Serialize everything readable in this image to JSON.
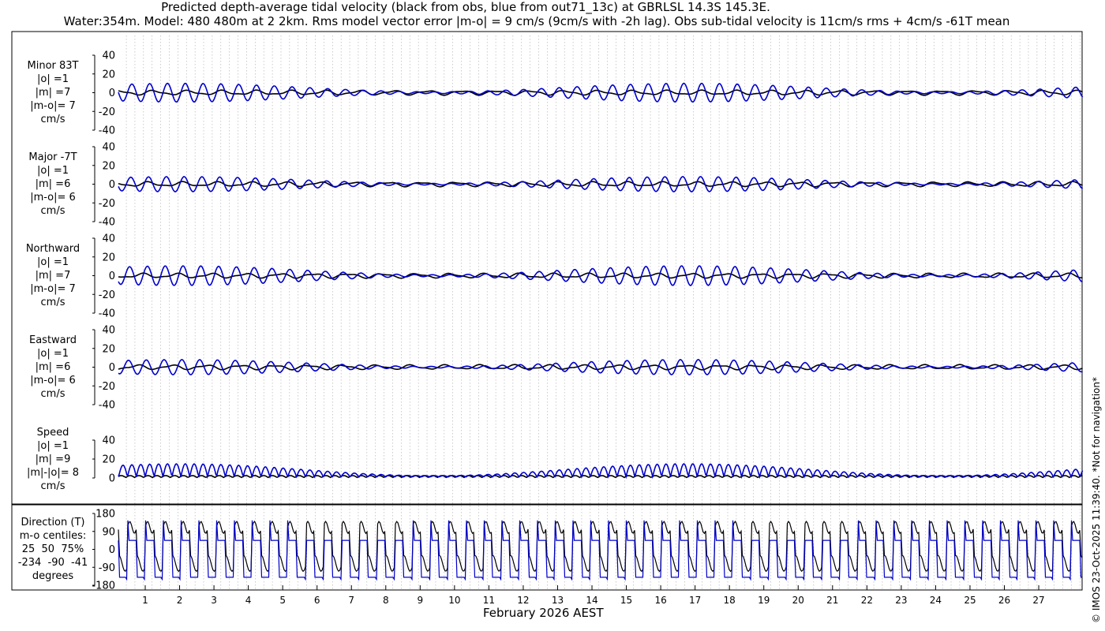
{
  "title": {
    "line1": "Predicted depth-average tidal velocity (black from obs, blue from out71_13c) at GBRLSL 14.3S 145.3E.",
    "line2": "Water:354m. Model: 480 480m at 2 2km. Rms model vector error |m-o| = 9 cm/s (9cm/s with -2h lag). Obs sub-tidal velocity is 11cm/s rms + 4cm/s -61T mean"
  },
  "xlabel": "February 2026 AEST",
  "copyright": "© IMOS 23-Oct-2025 11:39:40. *Not for navigation*",
  "colors": {
    "obs": "#000000",
    "model": "#0000cc",
    "grid": "#aaaaaa"
  },
  "chart_data": [
    {
      "type": "line",
      "panel": "minor",
      "label": [
        "Minor 83T",
        "|o| =1",
        "|m| =7",
        "|m-o|= 7",
        "cm/s"
      ],
      "yticks": [
        40,
        20,
        0,
        -20,
        -40
      ],
      "ylim": [
        -40,
        40
      ],
      "x_days": [
        1,
        27
      ],
      "series": [
        {
          "name": "obs",
          "amplitude": 2
        },
        {
          "name": "model",
          "amplitude": 10
        }
      ]
    },
    {
      "type": "line",
      "panel": "major",
      "label": [
        "Major -7T",
        "|o| =1",
        "|m| =6",
        "|m-o|= 6",
        "cm/s"
      ],
      "yticks": [
        40,
        20,
        0,
        -20,
        -40
      ],
      "ylim": [
        -40,
        40
      ],
      "series": [
        {
          "name": "obs",
          "amplitude": 2
        },
        {
          "name": "model",
          "amplitude": 9
        }
      ]
    },
    {
      "type": "line",
      "panel": "northward",
      "label": [
        "Northward",
        "|o| =1",
        "|m| =7",
        "|m-o|= 7",
        "cm/s"
      ],
      "yticks": [
        40,
        20,
        0,
        -20,
        -40
      ],
      "ylim": [
        -40,
        40
      ],
      "series": [
        {
          "name": "obs",
          "amplitude": 2
        },
        {
          "name": "model",
          "amplitude": 10
        }
      ]
    },
    {
      "type": "line",
      "panel": "eastward",
      "label": [
        "Eastward",
        "|o| =1",
        "|m| =6",
        "|m-o|= 6",
        "cm/s"
      ],
      "yticks": [
        40,
        20,
        0,
        -20,
        -40
      ],
      "ylim": [
        -40,
        40
      ],
      "series": [
        {
          "name": "obs",
          "amplitude": 2
        },
        {
          "name": "model",
          "amplitude": 9
        }
      ]
    },
    {
      "type": "line",
      "panel": "speed",
      "label": [
        "Speed",
        "|o| =1",
        "|m| =9",
        "|m|-|o|= 8",
        "cm/s"
      ],
      "yticks": [
        40,
        20,
        0
      ],
      "ylim": [
        0,
        40
      ],
      "series": [
        {
          "name": "obs",
          "amplitude": 2
        },
        {
          "name": "model",
          "amplitude": 14
        }
      ]
    },
    {
      "type": "line",
      "panel": "direction",
      "label": [
        "Direction (T)",
        "m-o centiles:",
        "25  50  75%",
        "-234  -90  -41",
        "degrees"
      ],
      "yticks": [
        180,
        90,
        0,
        -90,
        -180
      ],
      "ylim": [
        -180,
        180
      ],
      "series": [
        {
          "name": "obs"
        },
        {
          "name": "model"
        }
      ]
    }
  ],
  "xticks": [
    "1",
    "2",
    "3",
    "4",
    "5",
    "6",
    "7",
    "8",
    "9",
    "10",
    "11",
    "12",
    "13",
    "14",
    "15",
    "16",
    "17",
    "18",
    "19",
    "20",
    "21",
    "22",
    "23",
    "24",
    "25",
    "26",
    "27"
  ]
}
